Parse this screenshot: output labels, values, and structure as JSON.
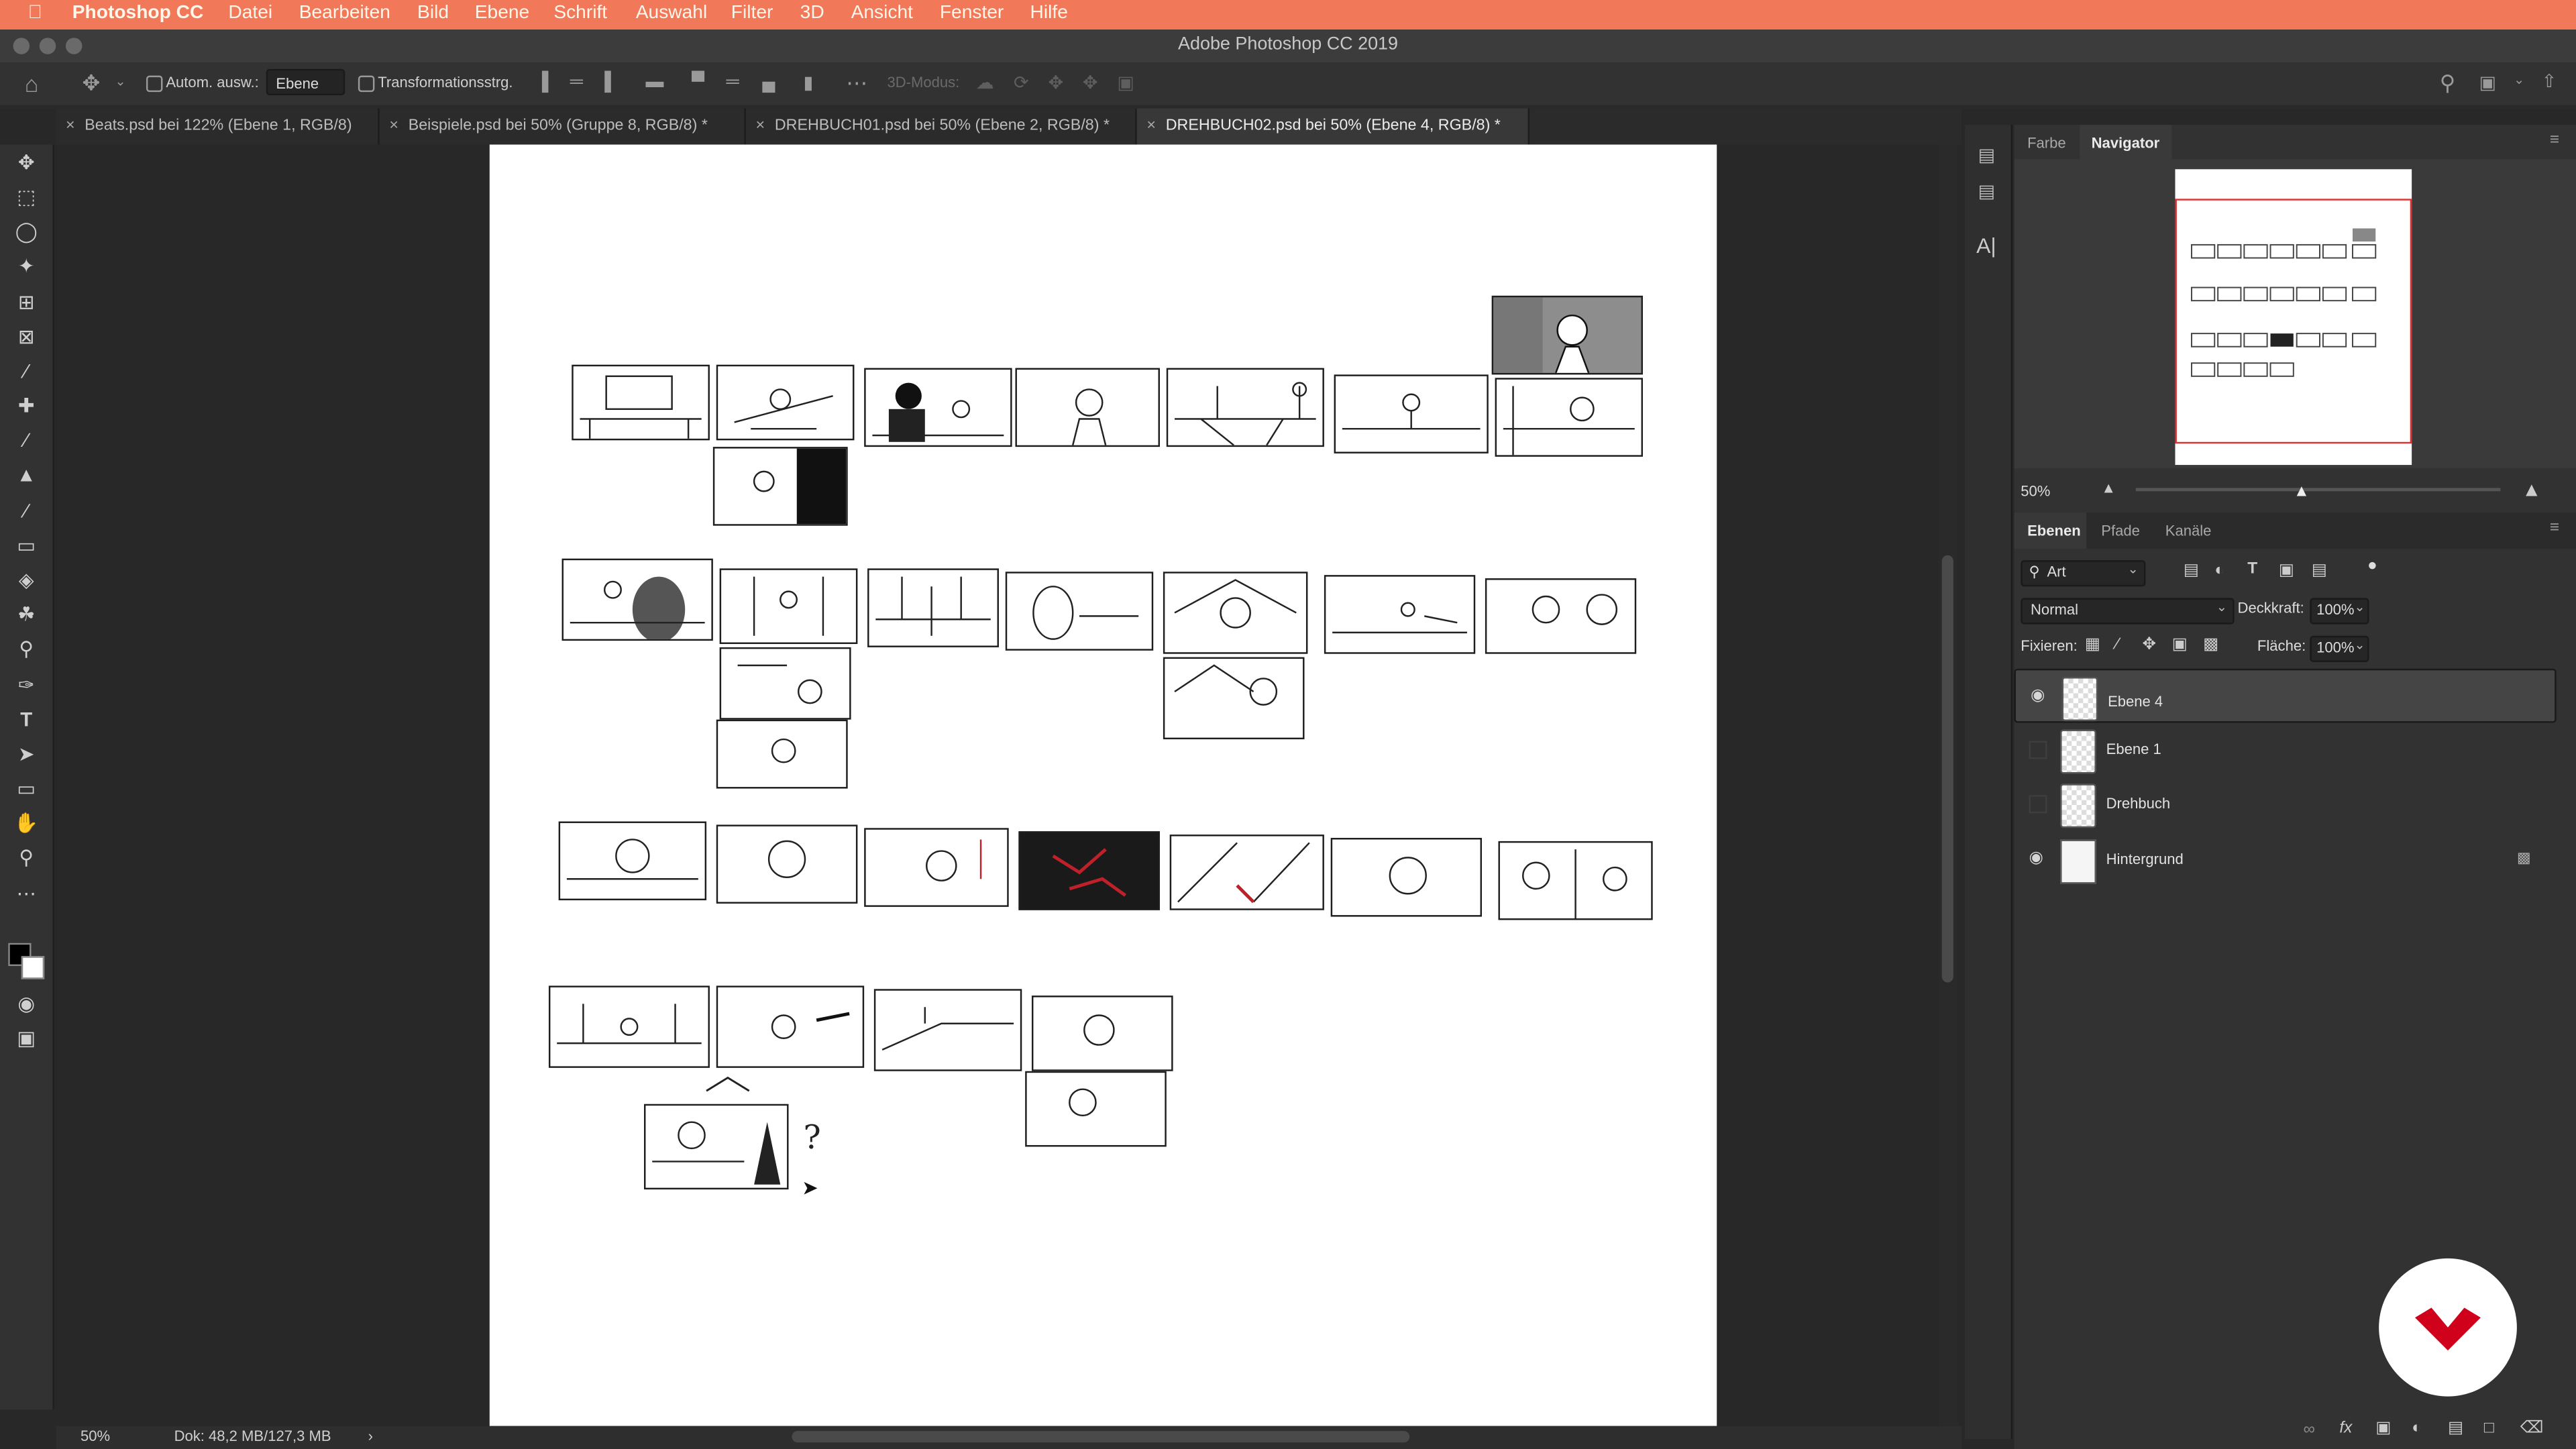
{
  "menubar": {
    "app": "Photoshop CC",
    "items": [
      "Datei",
      "Bearbeiten",
      "Bild",
      "Ebene",
      "Schrift",
      "Auswahl",
      "Filter",
      "3D",
      "Ansicht",
      "Fenster",
      "Hilfe"
    ]
  },
  "window": {
    "title": "Adobe Photoshop CC 2019"
  },
  "options": {
    "auto_select_label": "Autom. ausw.:",
    "auto_select_value": "Ebene",
    "transform_label": "Transformationsstrg.",
    "mode_3d_label": "3D-Modus:"
  },
  "tabs": [
    {
      "label": "Beats.psd bei 122% (Ebene 1, RGB/8)"
    },
    {
      "label": "Beispiele.psd bei 50% (Gruppe 8, RGB/8) *"
    },
    {
      "label": "DREHBUCH01.psd bei 50% (Ebene 2, RGB/8) *"
    },
    {
      "label": "DREHBUCH02.psd bei 50% (Ebene 4, RGB/8) *"
    }
  ],
  "active_tab": 3,
  "canvas": {
    "question_mark": "?"
  },
  "navigator": {
    "tab_color": "Farbe",
    "tab_navigator": "Navigator",
    "zoom": "50%"
  },
  "layers_panel": {
    "tabs": [
      "Ebenen",
      "Pfade",
      "Kanäle"
    ],
    "filter_kind": "Art",
    "blend_mode": "Normal",
    "opacity_label": "Deckkraft:",
    "opacity_value": "100%",
    "lock_label": "Fixieren:",
    "fill_label": "Fläche:",
    "fill_value": "100%",
    "layers": [
      {
        "name": "Ebene 4",
        "visible": true,
        "selected": true
      },
      {
        "name": "Ebene 1",
        "visible": false,
        "selected": false
      },
      {
        "name": "Drehbuch",
        "visible": false,
        "selected": false
      },
      {
        "name": "Hintergrund",
        "visible": true,
        "selected": false,
        "locked": true
      }
    ]
  },
  "status": {
    "zoom": "50%",
    "doc_size": "Dok: 48,2 MB/127,3 MB"
  },
  "colors": {
    "menubar": "#f2785a",
    "logo_red": "#d0021b"
  }
}
